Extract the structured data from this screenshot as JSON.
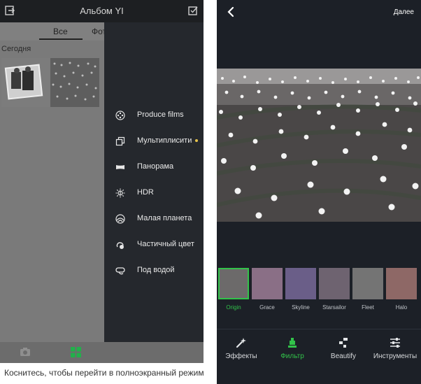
{
  "left_screen": {
    "title": "Альбом YI",
    "tabs": [
      "Все",
      "Фот"
    ],
    "section_date": "Сегодня",
    "menu": [
      {
        "label": "Produce films",
        "icon": "film-icon",
        "badge": false
      },
      {
        "label": "Мультиплисити",
        "icon": "copy-icon",
        "badge": true
      },
      {
        "label": "Панорама",
        "icon": "panorama-icon",
        "badge": false
      },
      {
        "label": "HDR",
        "icon": "hdr-icon",
        "badge": false
      },
      {
        "label": "Малая планета",
        "icon": "tiny-planet-icon",
        "badge": false
      },
      {
        "label": "Частичный цвет",
        "icon": "partial-color-icon",
        "badge": false
      },
      {
        "label": "Под водой",
        "icon": "underwater-icon",
        "badge": false
      }
    ],
    "bottom_nav": [
      "camera-icon",
      "grid-icon"
    ],
    "caption": "Коснитесь, чтобы перейти в полноэкранный режим",
    "accent": "#22b04b"
  },
  "right_screen": {
    "next_label": "Далее",
    "filters": [
      {
        "label": "Origin",
        "selected": true,
        "tint": "#6c6a6a"
      },
      {
        "label": "Grace",
        "selected": false,
        "tint": "#8a6f86"
      },
      {
        "label": "Skyline",
        "selected": false,
        "tint": "#6a5e88"
      },
      {
        "label": "Starsailor",
        "selected": false,
        "tint": "#6e6370"
      },
      {
        "label": "Fleet",
        "selected": false,
        "tint": "#747474"
      },
      {
        "label": "Halo",
        "selected": false,
        "tint": "#8e6866"
      }
    ],
    "toolbar": [
      {
        "label": "Эффекты",
        "icon": "magic-wand-icon",
        "active": false
      },
      {
        "label": "Фильтр",
        "icon": "filter-icon",
        "active": true
      },
      {
        "label": "Beautify",
        "icon": "beautify-icon",
        "active": false
      },
      {
        "label": "Инструменты",
        "icon": "sliders-icon",
        "active": false
      }
    ],
    "accent": "#32c24a"
  }
}
